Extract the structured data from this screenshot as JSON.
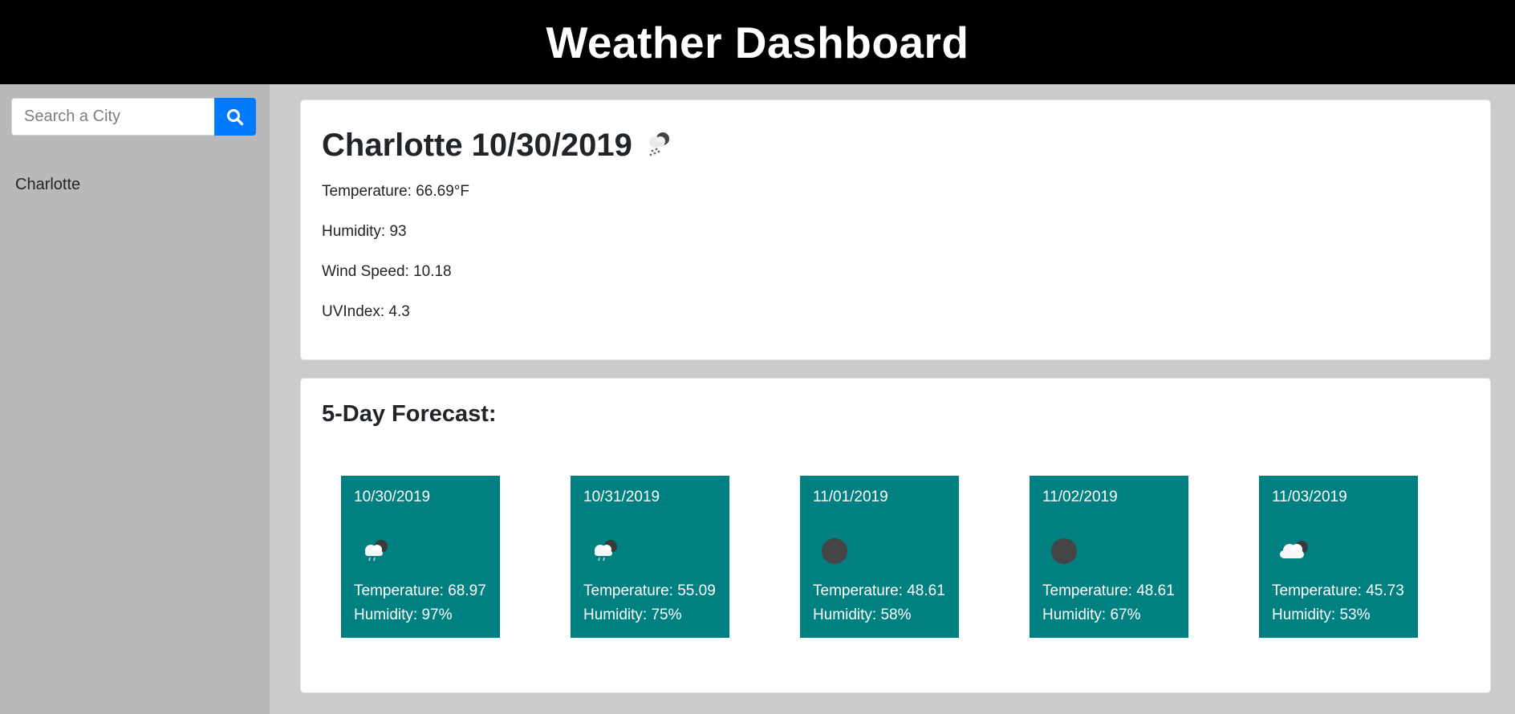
{
  "app": {
    "title": "Weather Dashboard"
  },
  "search": {
    "placeholder": "Search a City",
    "value": "",
    "icon": "search-icon"
  },
  "history": [
    "Charlotte"
  ],
  "current": {
    "title": "Charlotte 10/30/2019",
    "icon": "cloud-rain-icon",
    "temperature": "Temperature: 66.69°F",
    "humidity": "Humidity: 93",
    "wind": "Wind Speed: 10.18",
    "uv": "UVIndex: 4.3"
  },
  "forecast": {
    "title": "5-Day Forecast:",
    "days": [
      {
        "date": "10/30/2019",
        "icon": "cloud-rain-icon",
        "temp": "Temperature: 68.97",
        "humidity": "Humidity: 97%"
      },
      {
        "date": "10/31/2019",
        "icon": "cloud-rain-icon",
        "temp": "Temperature: 55.09",
        "humidity": "Humidity: 75%"
      },
      {
        "date": "11/01/2019",
        "icon": "dark-circle-icon",
        "temp": "Temperature: 48.61",
        "humidity": "Humidity: 58%"
      },
      {
        "date": "11/02/2019",
        "icon": "dark-circle-icon",
        "temp": "Temperature: 48.61",
        "humidity": "Humidity: 67%"
      },
      {
        "date": "11/03/2019",
        "icon": "cloud-icon",
        "temp": "Temperature: 45.73",
        "humidity": "Humidity: 53%"
      }
    ]
  },
  "colors": {
    "header": "#000000",
    "accent": "#007bff",
    "forecast_bg": "#008080",
    "sidebar": "#b9b9b9",
    "page": "#cbcbcb"
  }
}
